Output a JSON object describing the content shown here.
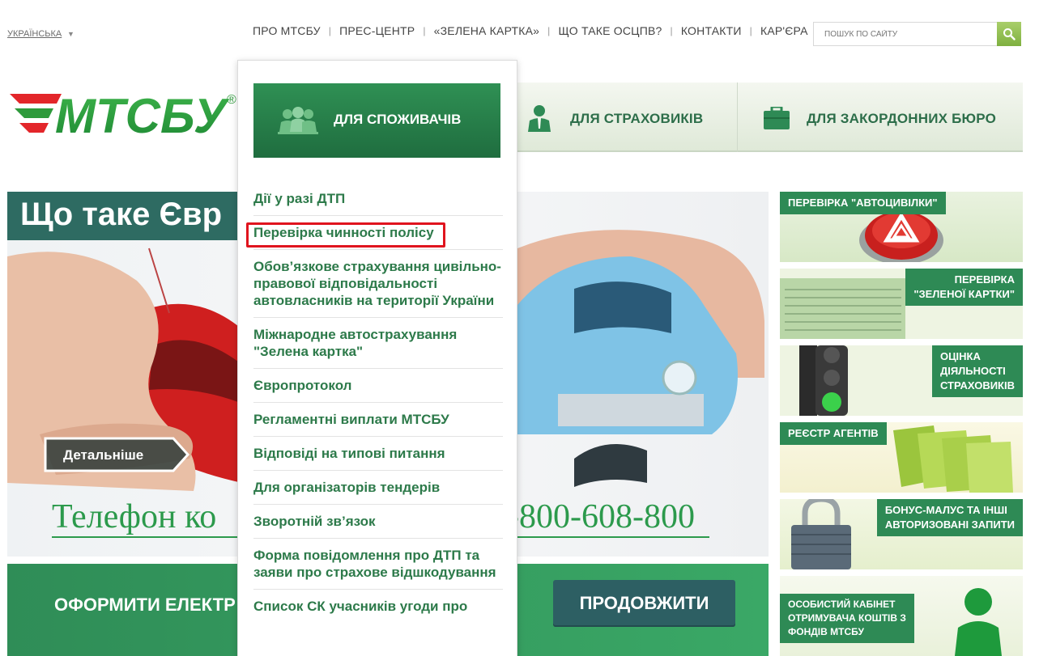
{
  "language": {
    "label": "УКРАЇНСЬКА"
  },
  "topnav": {
    "items": [
      "ПРО МТСБУ",
      "ПРЕС-ЦЕНТР",
      "«ЗЕЛЕНА КАРТКА»",
      "ЩО ТАКЕ ОСЦПВ?",
      "КОНТАКТИ",
      "КАР'ЄРА"
    ],
    "separator": "|"
  },
  "search": {
    "placeholder": "ПОШУК ПО САЙТУ",
    "icon": "search-icon"
  },
  "logo": {
    "text": "МТСБУ",
    "registered": "®",
    "color": "#2e9a3c"
  },
  "mainnav": {
    "consumers": "ДЛЯ СПОЖИВАЧІВ",
    "insurers": "ДЛЯ СТРАХОВИКІВ",
    "foreign_bureaus": "ДЛЯ ЗАКОРДОННИХ БЮРО"
  },
  "dropdown": {
    "items": [
      "Дії у разі ДТП",
      "Перевірка чинності полісу",
      "Обов’язкове страхування цивільно-правової відповідальності автовласників на території України",
      "Міжнародне автострахування \"Зелена картка\"",
      "Європротокол",
      "Регламентні виплати МТСБУ",
      "Відповіді на типові питання",
      "Для організаторів тендерів",
      "Зворотній зв’язок",
      "Форма повідомлення про ДТП та заяви про страхове відшкодування",
      "Список СК учасників угоди про"
    ],
    "highlighted_index": 1,
    "highlight_color": "#e0141e"
  },
  "banner": {
    "title": "Що таке Євр",
    "details_button": "Детальніше",
    "phone_left": "Телефон ко",
    "phone_right": "-800-608-800"
  },
  "cta": {
    "text": "ОФОРМИТИ ЕЛЕКТР",
    "button": "ПРОДОВЖИТИ"
  },
  "tiles": [
    {
      "label": "ПЕРЕВІРКА \"АВТОЦИВІЛКИ\""
    },
    {
      "label_line1": "ПЕРЕВІРКА",
      "label_line2": "\"ЗЕЛЕНОЇ КАРТКИ\""
    },
    {
      "label_line1": "ОЦІНКА",
      "label_line2": "ДІЯЛЬНОСТІ",
      "label_line3": "СТРАХОВИКІВ"
    },
    {
      "label": "РЕЄСТР АГЕНТІВ"
    },
    {
      "label_line1": "БОНУС-МАЛУС ТА ІНШІ",
      "label_line2": "АВТОРИЗОВАНІ ЗАПИТИ"
    },
    {
      "label_line1": "ОСОБИСТИЙ КАБІНЕТ",
      "label_line2": "ОТРИМУВАЧА КОШТІВ З",
      "label_line3": "ФОНДІВ МТСБУ"
    }
  ]
}
